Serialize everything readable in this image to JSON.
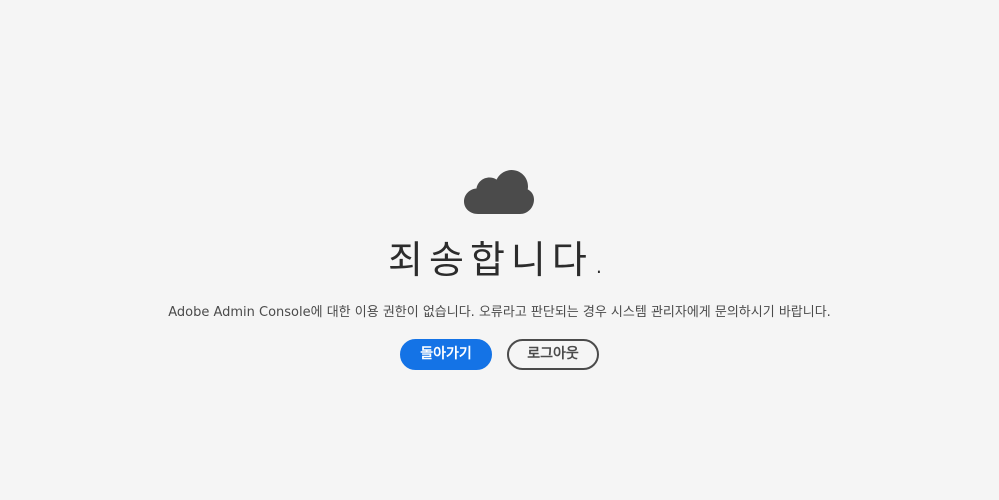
{
  "page": {
    "title": "죄송합니다.",
    "message": "Adobe Admin Console에 대한 이용 권한이 없습니다. 오류라고 판단되는 경우 시스템 관리자에게 문의하시기 바랍니다.",
    "icon": "cloud-icon"
  },
  "buttons": {
    "back_label": "돌아가기",
    "logout_label": "로그아웃"
  },
  "colors": {
    "background": "#f5f5f5",
    "primary": "#1473e6",
    "icon": "#4b4b4b",
    "text": "#2c2c2c"
  }
}
